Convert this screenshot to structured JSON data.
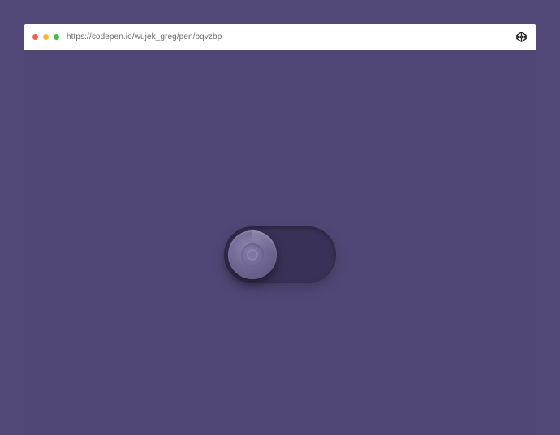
{
  "browser": {
    "url": "https://codepen.io/wujek_greg/pen/bqvzbp",
    "traffic_lights": [
      {
        "name": "close",
        "color": "#f25f58"
      },
      {
        "name": "minimize",
        "color": "#f8b731"
      },
      {
        "name": "maximize",
        "color": "#3cc145"
      }
    ],
    "icon": "codepen-icon"
  },
  "colors": {
    "page_background": "#534979",
    "content_background": "#514776",
    "toggle_track": "#3b3158",
    "toggle_knob": "#716893"
  },
  "toggle": {
    "state": "off"
  }
}
